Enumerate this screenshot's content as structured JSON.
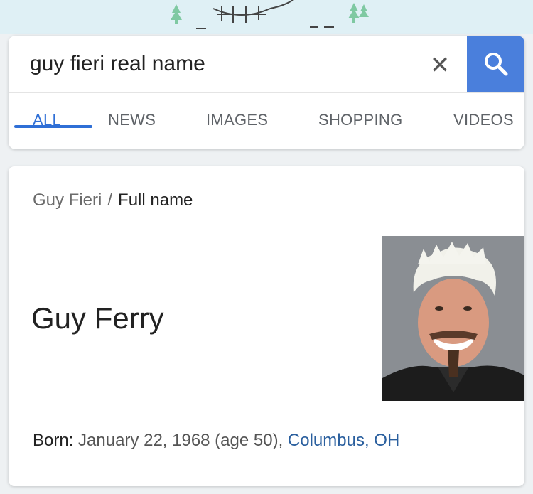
{
  "search": {
    "query": "guy fieri real name"
  },
  "icons": {
    "clear": "close-icon",
    "search": "search-icon",
    "clear_glyph": "✕"
  },
  "tabs": [
    {
      "label": "ALL",
      "active": true
    },
    {
      "label": "NEWS",
      "active": false
    },
    {
      "label": "IMAGES",
      "active": false
    },
    {
      "label": "SHOPPING",
      "active": false
    },
    {
      "label": "VIDEOS",
      "active": false
    }
  ],
  "result": {
    "breadcrumb_parent": "Guy Fieri",
    "breadcrumb_separator": "/",
    "breadcrumb_current": "Full name",
    "answer": "Guy Ferry",
    "born_label": "Born:",
    "born_date": " January 22, 1968 (age 50), ",
    "born_place": "Columbus, OH"
  },
  "colors": {
    "accent": "#4a7fdc",
    "active_tab": "#2f6fd6",
    "link": "#2a5f9e"
  }
}
